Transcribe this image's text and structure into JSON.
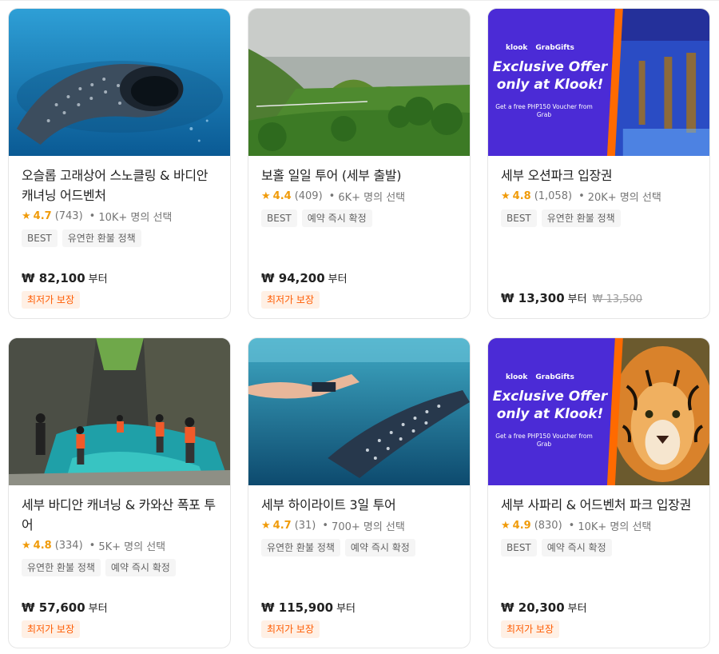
{
  "cards": [
    {
      "title": "오슬롭 고래상어 스노클링 & 바디안 캐녀닝 어드벤처",
      "rating": "4.7",
      "reviews": "(743)",
      "booked": "10K+ 명의 선택",
      "tags": [
        "BEST",
        "유연한 환불 정책"
      ],
      "price": "₩ 82,100",
      "price_unit": "부터",
      "badge": "최저가 보장"
    },
    {
      "title": "보홀 일일 투어 (세부 출발)",
      "rating": "4.4",
      "reviews": "(409)",
      "booked": "6K+ 명의 선택",
      "tags": [
        "BEST",
        "예약 즉시 확정"
      ],
      "price": "₩ 94,200",
      "price_unit": "부터",
      "badge": "최저가 보장"
    },
    {
      "title": "세부 오션파크 입장권",
      "rating": "4.8",
      "reviews": "(1,058)",
      "booked": "20K+ 명의 선택",
      "tags": [
        "BEST",
        "유연한 환불 정책"
      ],
      "price": "₩ 13,300",
      "price_unit": "부터",
      "old_price": "₩ 13,500",
      "promo": {
        "logo_left": "klook",
        "logo_right": "GrabGifts",
        "headline": "Exclusive Offer only at Klook!",
        "sub": "Get a free PHP150 Voucher from Grab"
      }
    },
    {
      "title": "세부 바디안 캐녀닝 & 카와산 폭포 투어",
      "rating": "4.8",
      "reviews": "(334)",
      "booked": "5K+ 명의 선택",
      "tags": [
        "유연한 환불 정책",
        "예약 즉시 확정"
      ],
      "price": "₩ 57,600",
      "price_unit": "부터",
      "badge": "최저가 보장"
    },
    {
      "title": "세부 하이라이트 3일 투어",
      "rating": "4.7",
      "reviews": "(31)",
      "booked": "700+ 명의 선택",
      "tags": [
        "유연한 환불 정책",
        "예약 즉시 확정"
      ],
      "price": "₩ 115,900",
      "price_unit": "부터",
      "badge": "최저가 보장"
    },
    {
      "title": "세부 사파리 & 어드벤처 파크 입장권",
      "rating": "4.9",
      "reviews": "(830)",
      "booked": "10K+ 명의 선택",
      "tags": [
        "BEST",
        "예약 즉시 확정"
      ],
      "price": "₩ 20,300",
      "price_unit": "부터",
      "badge": "최저가 보장",
      "promo": {
        "logo_left": "klook",
        "logo_right": "GrabGifts",
        "headline": "Exclusive Offer only at Klook!",
        "sub": "Get a free PHP150 Voucher from Grab"
      }
    }
  ],
  "icons": {
    "rating": "star-icon"
  },
  "colors": {
    "star": "#f09b0a",
    "badge_text": "#ff5b00",
    "badge_bg": "#fff0e5",
    "promo_bg": "#4b2bd6",
    "promo_accent": "#ff6a00"
  }
}
